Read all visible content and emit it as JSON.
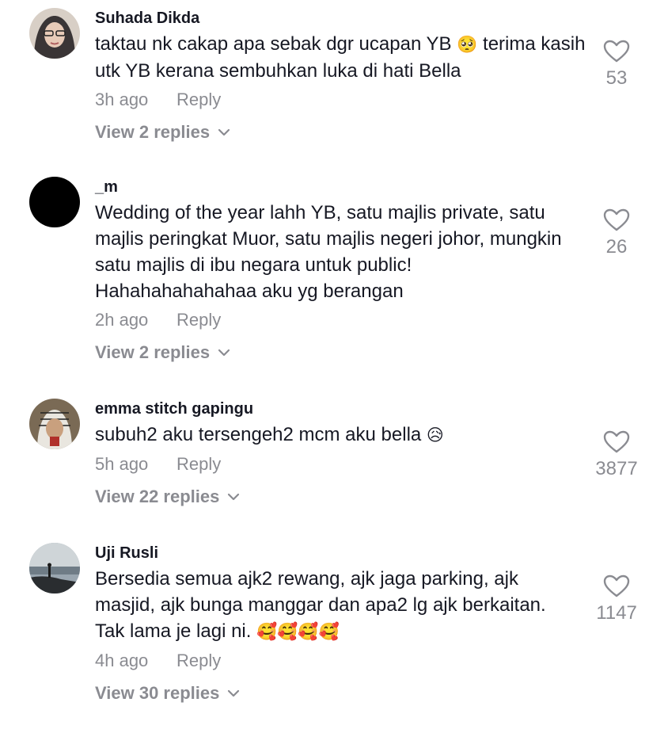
{
  "comments": [
    {
      "username": "Suhada Dikda",
      "text_before": "taktau nk cakap apa sebak dgr ucapan YB ",
      "emoji": "🥺",
      "text_after": " terima kasih utk YB kerana sembuhkan luka di hati Bella",
      "time": "3h ago",
      "reply_label": "Reply",
      "view_replies": "View 2 replies",
      "likes": "53"
    },
    {
      "username": "_m",
      "text_before": "Wedding of the year lahh YB, satu majlis private, satu majlis peringkat Muor, satu majlis negeri johor, mungkin satu majlis di ibu negara untuk public! Hahahahahahahaa aku yg berangan",
      "emoji": "",
      "text_after": "",
      "time": "2h ago",
      "reply_label": "Reply",
      "view_replies": "View 2 replies",
      "likes": "26"
    },
    {
      "username": "emma stitch gapingu",
      "text_before": "subuh2 aku tersengeh2 mcm aku bella ",
      "emoji": "😥",
      "text_after": "",
      "time": "5h ago",
      "reply_label": "Reply",
      "view_replies": "View 22 replies",
      "likes": "3877"
    },
    {
      "username": "Uji Rusli",
      "text_before": "Bersedia semua ajk2 rewang, ajk jaga parking, ajk masjid, ajk bunga manggar dan apa2 lg ajk berkaitan. Tak lama je lagi ni. ",
      "emoji": "🥰🥰🥰🥰",
      "text_after": "",
      "time": "4h ago",
      "reply_label": "Reply",
      "view_replies": "View 30 replies",
      "likes": "1147"
    }
  ],
  "colors": {
    "text": "#161823",
    "secondary": "#8a8b91"
  }
}
